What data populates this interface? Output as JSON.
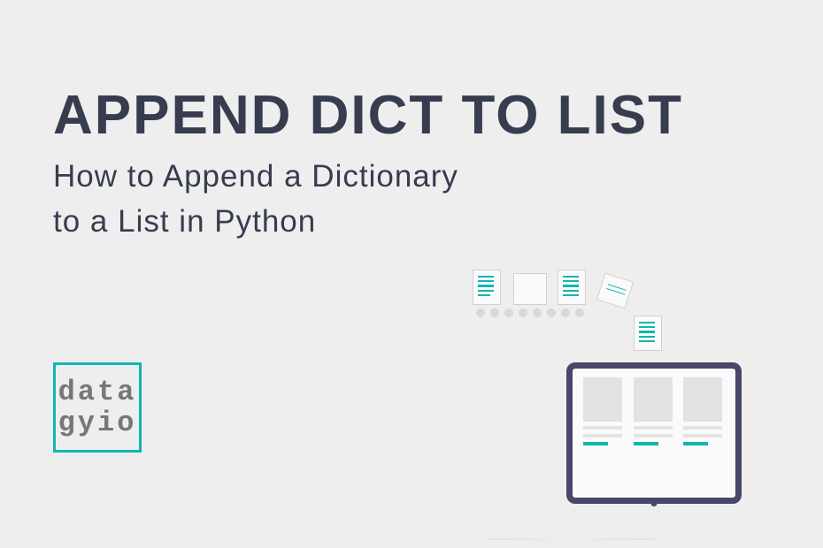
{
  "title": "APPEND DICT TO LIST",
  "subtitle_line1": "How to Append a Dictionary",
  "subtitle_line2": "to a List in Python",
  "logo": {
    "line1": "data",
    "line2": "gyio"
  }
}
